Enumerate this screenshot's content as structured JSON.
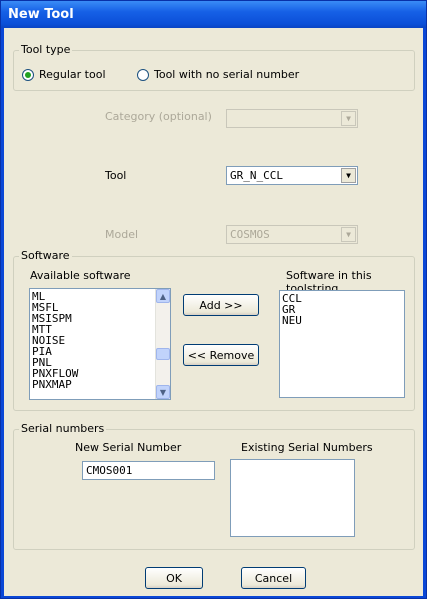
{
  "window": {
    "title": "New Tool"
  },
  "tool_type": {
    "legend": "Tool type",
    "options": [
      {
        "label": "Regular tool",
        "selected": true
      },
      {
        "label": "Tool with no serial number",
        "selected": false
      }
    ]
  },
  "fields": {
    "category": {
      "label": "Category (optional)",
      "value": ""
    },
    "tool": {
      "label": "Tool",
      "value": "GR_N_CCL"
    },
    "model": {
      "label": "Model",
      "value": "COSMOS"
    }
  },
  "software": {
    "legend": "Software",
    "available_label": "Available software",
    "available_items": [
      "ML",
      "MSFL",
      "MSISPM",
      "MTT",
      "NOISE",
      "PIA",
      "PNL",
      "PNXFLOW",
      "PNXMAP"
    ],
    "toolstring_label": "Software in this toolstring",
    "toolstring_items": [
      "CCL",
      "GR",
      "NEU"
    ],
    "add_label": "Add >>",
    "remove_label": "<< Remove"
  },
  "serials": {
    "legend": "Serial numbers",
    "new_label": "New Serial Number",
    "new_value": "CMOS001",
    "existing_label": "Existing Serial Numbers",
    "existing_items": []
  },
  "buttons": {
    "ok": "OK",
    "cancel": "Cancel"
  }
}
